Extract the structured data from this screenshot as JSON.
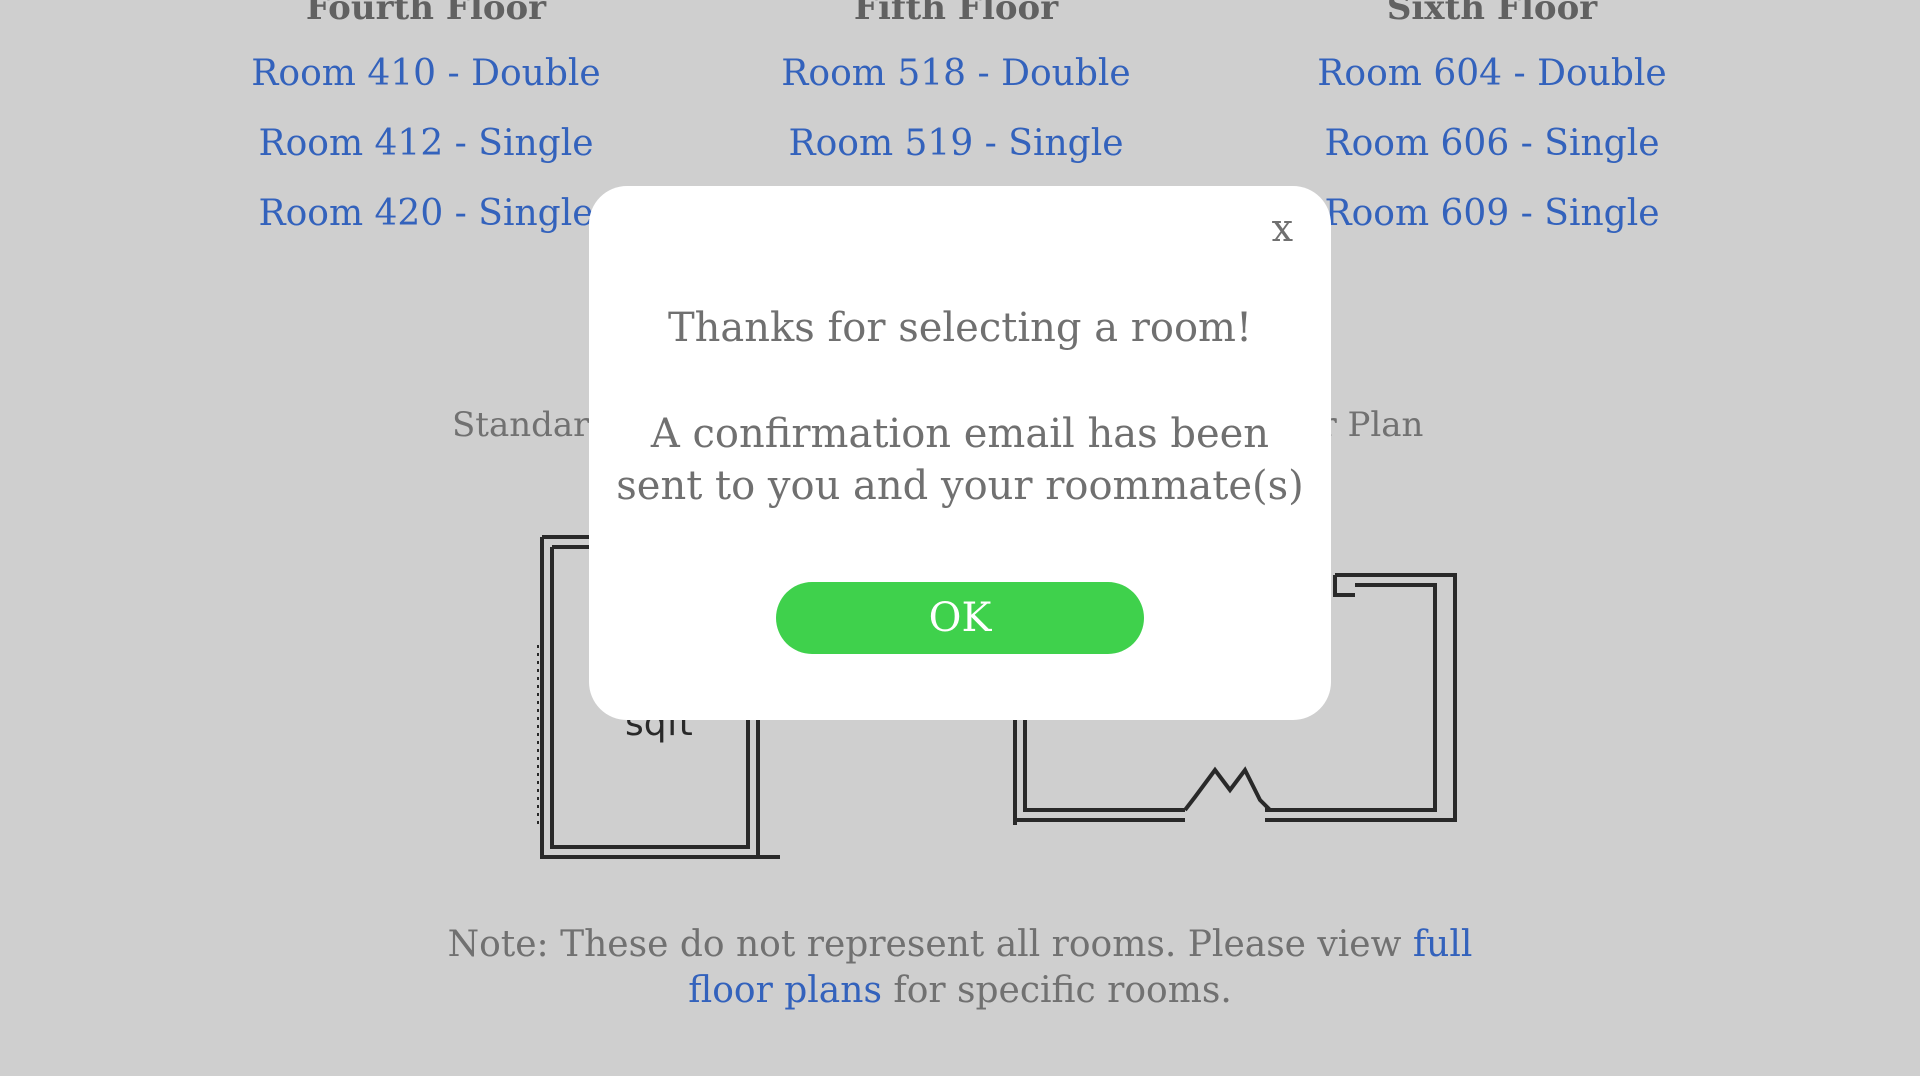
{
  "floors": [
    {
      "title": "Fourth Floor",
      "rooms": [
        "Room 410 - Double",
        "Room 412 - Single",
        "Room 420 - Single"
      ]
    },
    {
      "title": "Fifth Floor",
      "rooms": [
        "Room 518 - Double",
        "Room 519 - Single"
      ]
    },
    {
      "title": "Sixth Floor",
      "rooms": [
        "Room 604 - Double",
        "Room 606 - Single",
        "Room 609 - Single"
      ]
    }
  ],
  "plans": {
    "left_caption": "Standard",
    "right_caption": "or Plan",
    "left_area_label": "sqft"
  },
  "note": {
    "prefix": "Note: These do not represent all rooms. Please view ",
    "link": "full floor plans",
    "suffix": " for specific rooms."
  },
  "modal": {
    "close_label": "x",
    "title": "Thanks for selecting a room!",
    "message": "A confirmation email has been sent to you and your roommate(s)",
    "ok_label": "OK"
  },
  "colors": {
    "link": "#3f78e6",
    "ok_button": "#3fd14c",
    "text_muted": "#707070"
  }
}
